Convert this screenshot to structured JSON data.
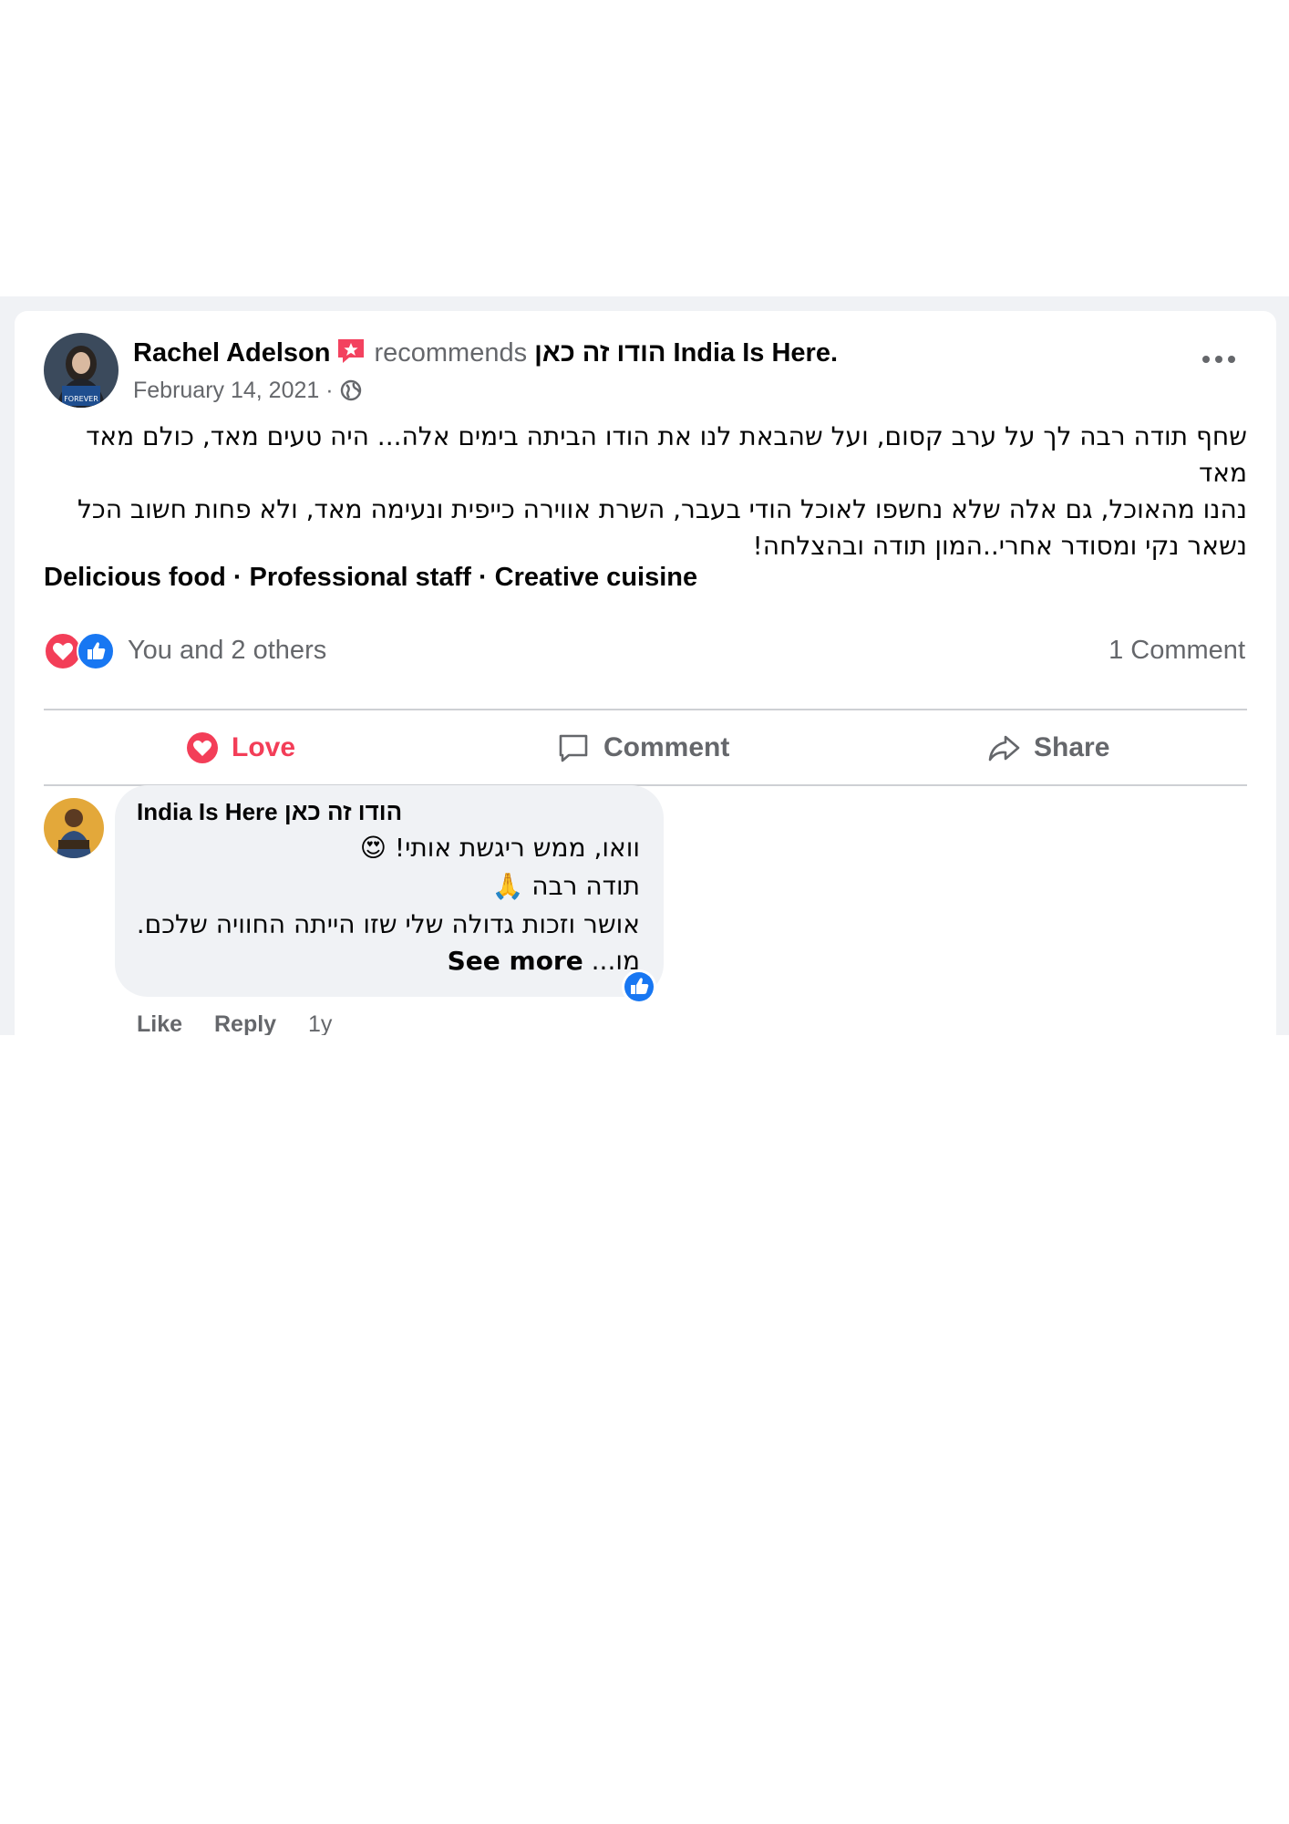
{
  "post": {
    "author": "Rachel Adelson",
    "action": "recommends",
    "page_name": "הודו זה כאן India Is Here.",
    "date": "February 14, 2021 ·",
    "body_lines": [
      "שחף תודה רבה לך על ערב קסום, ועל שהבאת לנו את הודו הביתה בימים אלה... היה טעים מאד, כולם מאד מאד",
      "נהנו מהאוכל, גם אלה שלא נחשפו לאוכל הודי בעבר, השרת אווירה כייפית ונעימה מאד,  ולא פחות חשוב הכל",
      "נשאר נקי ומסודר אחרי..המון תודה ובהצלחה!"
    ],
    "tags": "Delicious food · Professional staff · Creative cuisine",
    "reactions_text": "You and 2 others",
    "comment_count": "1 Comment"
  },
  "actions": {
    "love": "Love",
    "comment": "Comment",
    "share": "Share"
  },
  "comment": {
    "author": "India Is Here הודו זה כאן",
    "lines": [
      "וואו, ממש ריגשת אותי! 😍",
      "תודה רבה 🙏",
      "אושר וזכות גדולה שלי שזו הייתה החוויה שלכם."
    ],
    "truncated": "מו...",
    "see_more": "See more",
    "like": "Like",
    "reply": "Reply",
    "time": "1y"
  },
  "colors": {
    "love": "#f33e58",
    "like": "#1877f2",
    "muted": "#65676b",
    "band": "#f0f2f5"
  },
  "icons": [
    "more-options-icon",
    "globe-icon",
    "recommend-badge-icon",
    "love-icon",
    "like-icon",
    "comment-icon",
    "share-icon"
  ]
}
